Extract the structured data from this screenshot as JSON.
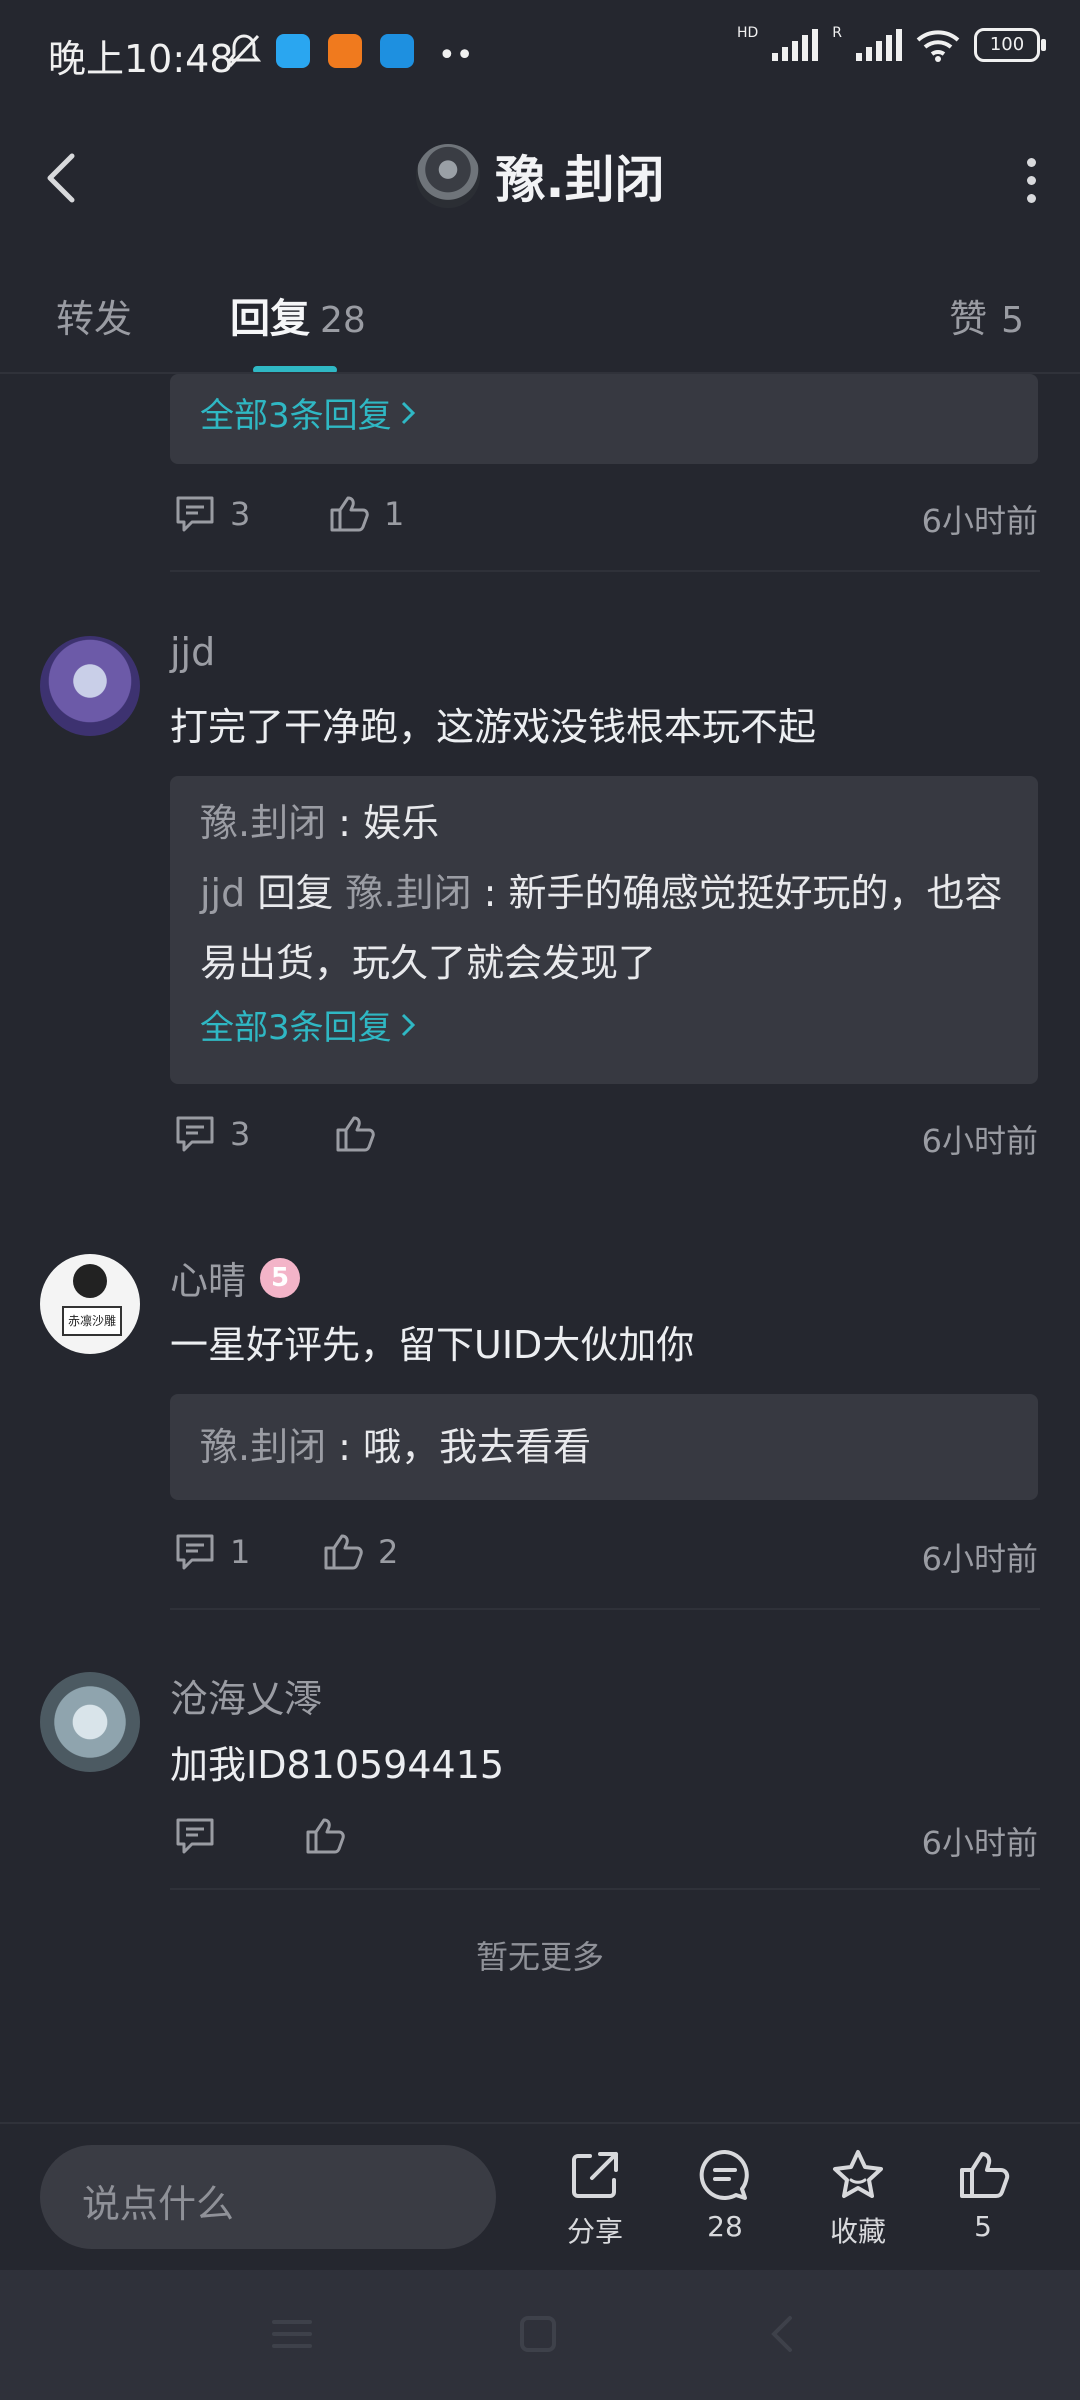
{
  "status_bar": {
    "time": "晚上10:48",
    "battery": "100",
    "hd": "HD",
    "r": "R"
  },
  "header": {
    "title": "豫.刲闭"
  },
  "tabs": [
    {
      "label": "转发"
    },
    {
      "label": "回复",
      "count": "28"
    },
    {
      "label": "赞",
      "count": "5"
    }
  ],
  "comment0": {
    "more_replies": "全部3条回复",
    "reply_count": "3",
    "like_count": "1",
    "time": "6小时前"
  },
  "comment1": {
    "username": "jjd",
    "text": "打完了干净跑，这游戏没钱根本玩不起",
    "replies": [
      {
        "name": "豫.刲闭",
        "text": "娱乐"
      },
      {
        "name": "jjd",
        "reply_word": "回复",
        "target": "豫.刲闭",
        "text": "新手的确感觉挺好玩的，也容易出货，玩久了就会发现了"
      }
    ],
    "more_replies": "全部3条回复",
    "reply_count": "3",
    "time": "6小时前"
  },
  "comment2": {
    "username": "心晴",
    "level": "5",
    "text": "一星好评先，留下UID大伙加你",
    "avatar_sign": "赤凛沙雕",
    "replies": [
      {
        "name": "豫.刲闭",
        "text": "哦，我去看看"
      }
    ],
    "reply_count": "1",
    "like_count": "2",
    "time": "6小时前"
  },
  "comment3": {
    "username": "沧海乂澪",
    "text": "加我ID810594415",
    "time": "6小时前"
  },
  "no_more": "暂无更多",
  "bottom": {
    "input_placeholder": "说点什么",
    "share_label": "分享",
    "comment_count": "28",
    "favorite_label": "收藏",
    "like_count": "5"
  }
}
